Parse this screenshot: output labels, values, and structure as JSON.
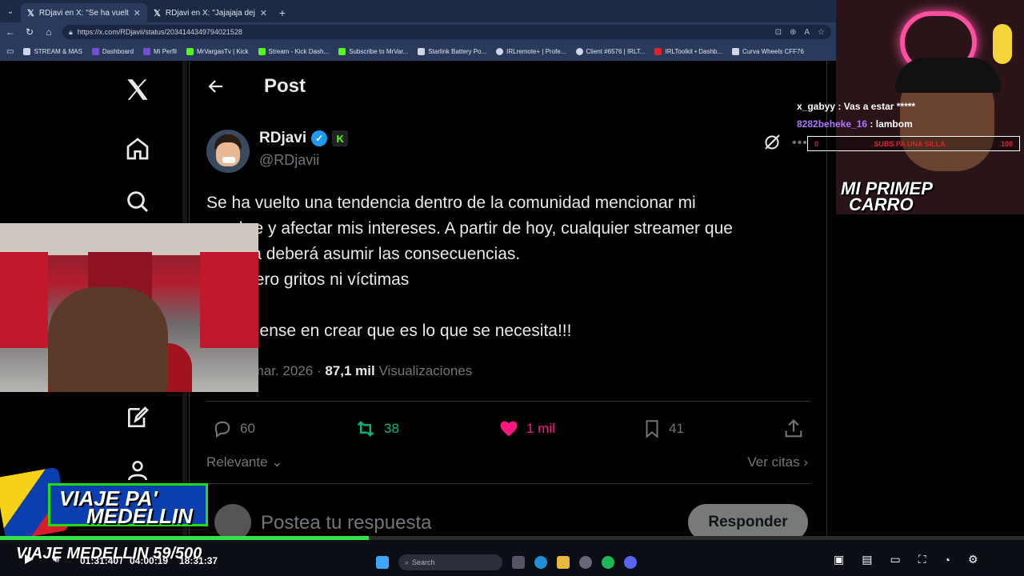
{
  "browser": {
    "tabs": [
      {
        "title": "RDjavi en X: \"Se ha vuelto una ten",
        "active": true
      },
      {
        "title": "RDjavi en X: \"Jajajaja dejen el prot",
        "active": false
      }
    ],
    "url": "https://x.com/RDjavii/status/2034144349794021528",
    "bookmarks": [
      {
        "label": "STREAM & MAS",
        "color": "#cfd6e6"
      },
      {
        "label": "Dashboard",
        "color": "#7b4bd6"
      },
      {
        "label": "Mi Perfil",
        "color": "#7b4bd6"
      },
      {
        "label": "MrVargasTv | Kick",
        "color": "#53fc18"
      },
      {
        "label": "Stream - Kick Dash...",
        "color": "#53fc18"
      },
      {
        "label": "Subscribe to MrVar...",
        "color": "#53fc18"
      },
      {
        "label": "Starlink Battery Po...",
        "color": "#cfd6e6"
      },
      {
        "label": "IRLremote+ | Profe...",
        "color": "#cfd6e6"
      },
      {
        "label": "Client #6576 | IRLT...",
        "color": "#cfd6e6"
      },
      {
        "label": "IRLToolkit • Dashb...",
        "color": "#e0212f"
      },
      {
        "label": "Curva Wheels CFF76",
        "color": "#cfd6e6"
      }
    ]
  },
  "x_page": {
    "header_title": "Post",
    "author": {
      "name": "RDjavi",
      "handle": "@RDjavii",
      "kick_badge": "K"
    },
    "tweet_lines": [
      "Se ha vuelto una tendencia dentro de la comunidad mencionar mi",
      "nombre y afectar mis intereses. A partir de hoy, cualquier streamer que",
      "lo haga deberá asumir las consecuencias.",
      "No quiero gritos ni víctimas",
      "",
      "Enfóquense en crear que es lo que se necesita!!!"
    ],
    "meta": {
      "time_date": "m. · 18 mar. 2026 · ",
      "views_count": "87,1 mil",
      "views_label": " Visualizaciones"
    },
    "actions": {
      "replies": "60",
      "reposts": "38",
      "likes": "1 mil",
      "bookmarks": "41"
    },
    "sort_label": "Relevante",
    "quotes_link": "Ver citas",
    "reply_placeholder": "Postea tu respuesta",
    "reply_button": "Responder"
  },
  "stream_overlay": {
    "chat": [
      {
        "user": "x_gabyy",
        "message": "Vas a estar *****",
        "color": "#ffffff"
      },
      {
        "user": "8282beheke_16",
        "message": "lambom",
        "color": "#b077ff"
      }
    ],
    "sub_goal": {
      "left": "0",
      "label": "SUBS PA UNA SILLA",
      "right": "100"
    },
    "cam_title_line1": "MI PRIMEP",
    "cam_title_line2": "CARRO",
    "promo_line1": "VIAJE PA'",
    "promo_line2": "MEDELLIN",
    "goal_text": "VIAJE MEDELLIN 59/500",
    "progress": 0.36
  },
  "player": {
    "time_elapsed": "01:31:40",
    "time_total": "04:00:19",
    "clock": "18:31:37",
    "taskbar_search": "Search"
  }
}
